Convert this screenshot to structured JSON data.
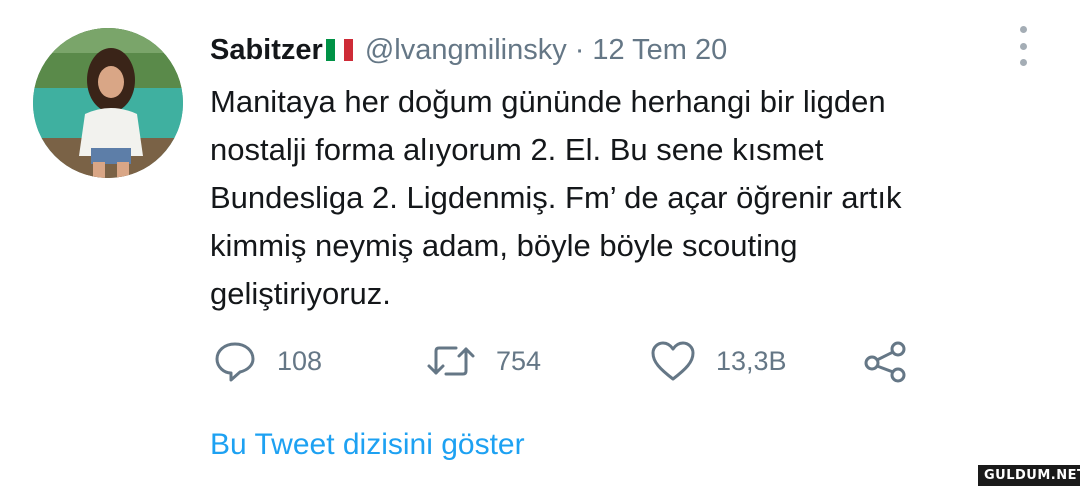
{
  "author": {
    "display_name": "Sabitzer",
    "flag_colors": [
      "#009246",
      "#ffffff",
      "#ce2b37"
    ],
    "handle": "@lvangmilinsky",
    "separator": "·",
    "timestamp": "12 Tem 20"
  },
  "tweet": {
    "lines": [
      "Manitaya her doğum gününde herhangi bir ligden",
      "nostalji forma alıyorum 2. El. Bu sene kısmet",
      "Bundesliga 2. Ligdenmiş. Fm’ de açar öğrenir artık",
      "kimmiş neymiş adam, böyle böyle scouting",
      "geliştiriyoruz."
    ]
  },
  "actions": {
    "reply": {
      "icon": "reply-icon",
      "count": "108"
    },
    "retweet": {
      "icon": "retweet-icon",
      "count": "754"
    },
    "like": {
      "icon": "heart-icon",
      "count": "13,3B"
    },
    "share": {
      "icon": "share-icon"
    }
  },
  "show_thread_label": "Bu Tweet dizisini göster",
  "watermark": "GULDUM.NET",
  "colors": {
    "text": "#14171a",
    "secondary": "#657786",
    "link": "#1da1f2",
    "icon": "#657786"
  }
}
